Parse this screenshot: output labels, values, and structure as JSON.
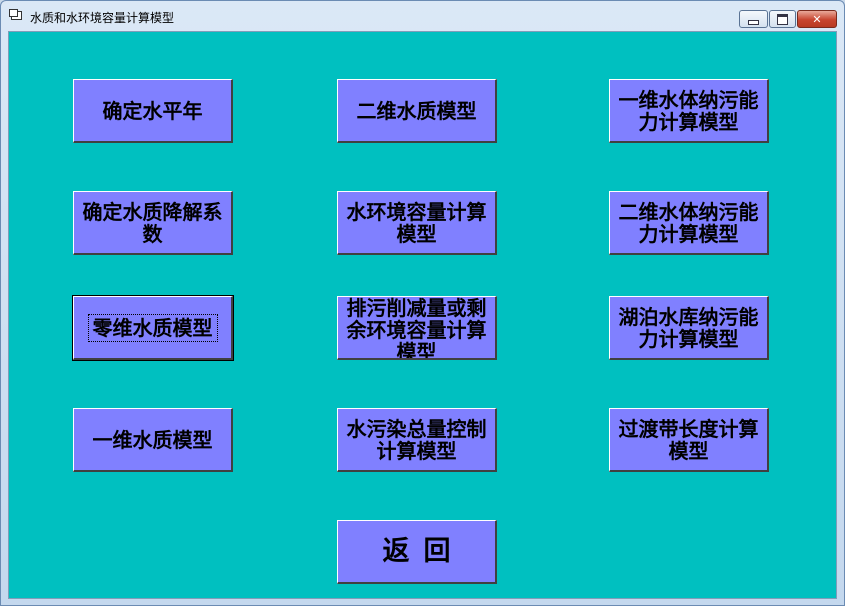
{
  "window": {
    "title": "水质和水环境容量计算模型",
    "controls": {
      "close": "✕"
    }
  },
  "buttons": {
    "determine_year": "确定水平年",
    "degradation_coef": "确定水质降解系数",
    "zero_dim_model": "零维水质模型",
    "one_dim_model": "一维水质模型",
    "two_dim_model": "二维水质模型",
    "capacity_model": "水环境容量计算模型",
    "reduction_model": "排污削减量或剩余环境容量计算模型",
    "total_control_model": "水污染总量控制计算模型",
    "one_dim_absorb": "一维水体纳污能力计算模型",
    "two_dim_absorb": "二维水体纳污能力计算模型",
    "lake_absorb": "湖泊水库纳污能力计算模型",
    "transition_length": "过渡带长度计算模型",
    "back": "返回"
  },
  "colors": {
    "client_bg": "#00c0c0",
    "button_bg": "#8080ff"
  }
}
